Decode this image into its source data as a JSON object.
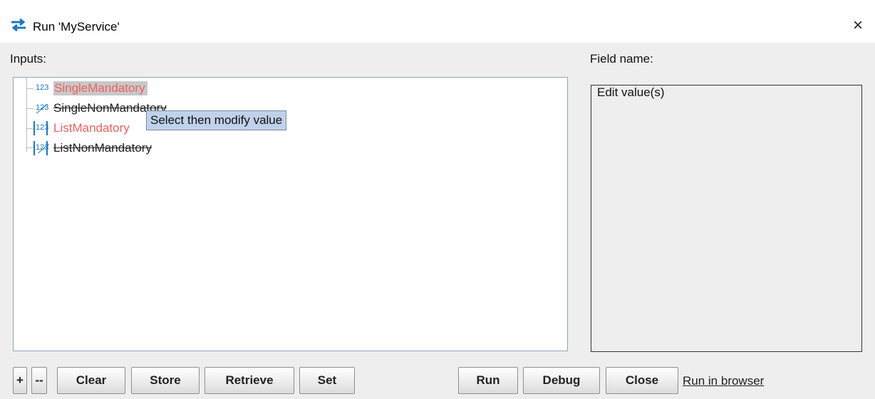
{
  "window": {
    "title": "Run 'MyService'",
    "title_icon": "swap-arrows-icon",
    "close_icon": "close-icon",
    "close_glyph": "×"
  },
  "inputs_label": "Inputs:",
  "field_name_label": "Field name:",
  "edit_values_label": "Edit value(s)",
  "tree": {
    "nodes": [
      {
        "label": "SingleMandatory",
        "icon_text": "123",
        "icon": "numeric-single-icon",
        "mandatory": true,
        "selected": true
      },
      {
        "label": "SingleNonMandatory",
        "icon_text": "123",
        "icon": "numeric-single-optional-icon",
        "mandatory": false
      },
      {
        "label": "ListMandatory",
        "icon_text": "123",
        "icon": "numeric-list-icon",
        "mandatory": true
      },
      {
        "label": "ListNonMandatory",
        "icon_text": "123",
        "icon": "numeric-list-optional-icon",
        "mandatory": false
      }
    ]
  },
  "tooltip": "Select then modify value",
  "buttons": {
    "add": "+",
    "remove": "--",
    "clear": "Clear",
    "store": "Store",
    "retrieve": "Retrieve",
    "set": "Set",
    "run": "Run",
    "debug": "Debug",
    "close": "Close"
  },
  "run_in_browser": "Run in browser",
  "colors": {
    "mandatory": "#ee6060",
    "icon": "#1a78c2",
    "tooltip_bg": "#bfd2ea",
    "title_icon": "#1a78c2"
  }
}
